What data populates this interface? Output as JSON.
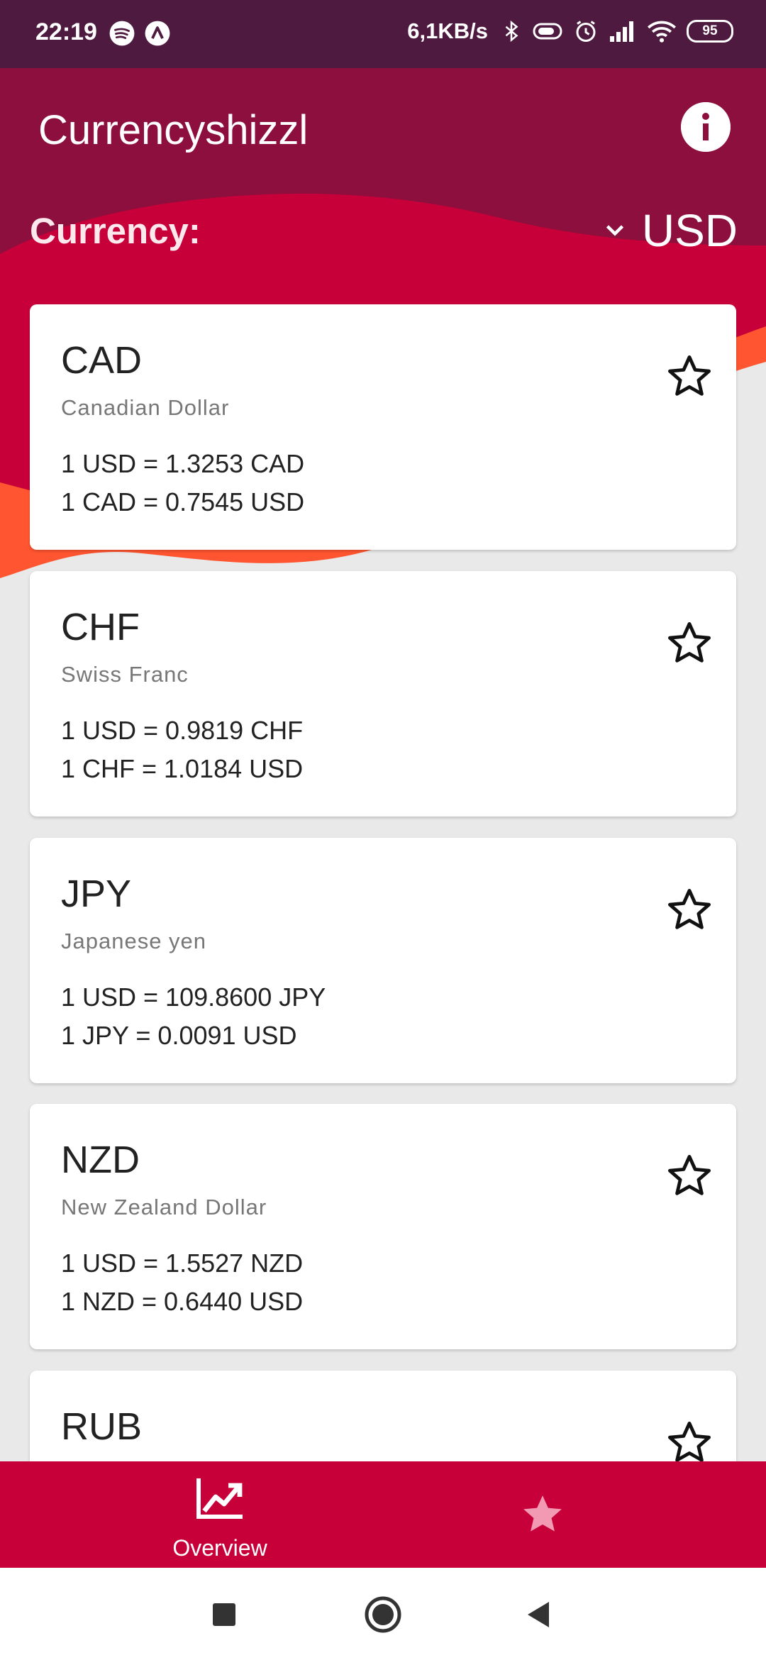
{
  "status_bar": {
    "time": "22:19",
    "network_speed": "6,1KB/s",
    "battery": "95",
    "icons": [
      "spotify-icon",
      "app-icon",
      "bluetooth-icon",
      "vibrate-icon",
      "alarm-icon",
      "signal-icon",
      "wifi-icon",
      "battery-icon"
    ]
  },
  "header": {
    "title": "Currencyshizzl",
    "currency_label": "Currency:",
    "selected_currency": "USD",
    "icons": [
      "info-icon",
      "chevron-down-icon"
    ]
  },
  "currencies": [
    {
      "code": "CAD",
      "name": "Canadian Dollar",
      "rate_line_1": "1 USD = 1.3253 CAD",
      "rate_line_2": "1 CAD = 0.7545 USD"
    },
    {
      "code": "CHF",
      "name": "Swiss Franc",
      "rate_line_1": "1 USD = 0.9819 CHF",
      "rate_line_2": "1 CHF = 1.0184 USD"
    },
    {
      "code": "JPY",
      "name": "Japanese yen",
      "rate_line_1": "1 USD = 109.8600 JPY",
      "rate_line_2": "1 JPY = 0.0091 USD"
    },
    {
      "code": "NZD",
      "name": "New Zealand Dollar",
      "rate_line_1": "1 USD = 1.5527 NZD",
      "rate_line_2": "1 NZD = 0.6440 USD"
    },
    {
      "code": "RUB",
      "name": "",
      "rate_line_1": "",
      "rate_line_2": ""
    }
  ],
  "bottom_nav": {
    "overview_label": "Overview",
    "icons": [
      "chart-trending-icon",
      "star-icon"
    ]
  },
  "colors": {
    "status_bar": "#4e1a40",
    "header_dark": "#8c0f3e",
    "primary": "#c8003a",
    "accent_orange": "#ff5530",
    "background": "#e9e9e9"
  }
}
